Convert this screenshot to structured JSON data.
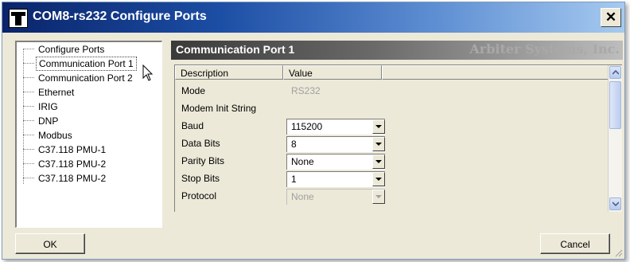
{
  "window": {
    "title": "COM8-rs232 Configure Ports",
    "close_label": "✕"
  },
  "tree": {
    "items": [
      {
        "label": "Configure Ports"
      },
      {
        "label": "Communication Port 1",
        "selected": true
      },
      {
        "label": "Communication Port 2"
      },
      {
        "label": "Ethernet"
      },
      {
        "label": "IRIG"
      },
      {
        "label": "DNP"
      },
      {
        "label": "Modbus"
      },
      {
        "label": "C37.118 PMU-1"
      },
      {
        "label": "C37.118 PMU-2"
      },
      {
        "label": "C37.118 PMU-2"
      }
    ]
  },
  "panel": {
    "title": "Communication Port 1",
    "brand": "Arbiter Systems, Inc."
  },
  "grid": {
    "columns": [
      "Description",
      "Value"
    ],
    "rows": [
      {
        "description": "Mode",
        "value": "RS232",
        "control": "readonly"
      },
      {
        "description": "Modem Init String",
        "value": "",
        "control": "none"
      },
      {
        "description": "Baud",
        "value": "115200",
        "control": "combo"
      },
      {
        "description": "Data Bits",
        "value": "8",
        "control": "combo"
      },
      {
        "description": "Parity Bits",
        "value": "None",
        "control": "combo"
      },
      {
        "description": "Stop Bits",
        "value": "1",
        "control": "combo"
      },
      {
        "description": "Protocol",
        "value": "None",
        "control": "combo-disabled"
      }
    ]
  },
  "buttons": {
    "ok": "OK",
    "cancel": "Cancel"
  },
  "colors": {
    "title_start": "#0a246a",
    "title_end": "#a6caf0",
    "dialog_bg": "#ece9d8"
  },
  "icons": [
    "app-icon",
    "close-icon",
    "cursor-icon",
    "chevron-up-icon",
    "chevron-down-icon",
    "dropdown-arrow-icon",
    "resize-grip-icon"
  ]
}
